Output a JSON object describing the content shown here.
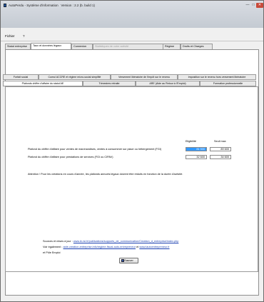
{
  "window": {
    "title": "AutoPerdu - Système d'information",
    "version": "Version : 2.2 (b. build 1)",
    "controls": {
      "minimize": "—",
      "maximize": "□",
      "close": "✕"
    }
  },
  "menu": {
    "file": "Fichier",
    "help": "?"
  },
  "tabs": [
    {
      "label": "Statut entreprise"
    },
    {
      "label": "Taux et données légaux"
    },
    {
      "label": "Connexion"
    },
    {
      "label": "Statistiques de votre activité"
    },
    {
      "label": "Régime"
    },
    {
      "label": "Droits et Charges"
    }
  ],
  "subtabs_row1": [
    {
      "label": "Forfait social"
    },
    {
      "label": "Cumul ACCRE et régime micro-social simplifié"
    },
    {
      "label": "Versement libératoire de l'impôt sur le revenu"
    },
    {
      "label": "Imposition sur le revenu hors versement libératoire"
    }
  ],
  "subtabs_row2": [
    {
      "label": "Plafonds chiffre d'affaire du statut AE"
    },
    {
      "label": "Trimestres retraite"
    },
    {
      "label": "ARE (Aide au Retour à l'Emploi)"
    },
    {
      "label": "Formation professionnelle"
    }
  ],
  "plafonds": {
    "col_eligibility": "Eligibilité",
    "col_threshold": "Seuil max",
    "rows": [
      {
        "label": "Plafond du chiffre d'affaire pour ventes de marchandises, ventes à consommer sur place ou hébergement  (FGI)",
        "eligibility": "81 500",
        "threshold": "89 600"
      },
      {
        "label": "Plafond du chiffre d'affaire pour prestations de services (FGI ou CIPAV)",
        "eligibility": "32 600",
        "threshold": "34 600"
      }
    ],
    "note": "Attention ! Pour les créations en cours d'année, les plafonds annuels légaux doivent être réduits en fonction de la durée d'activité."
  },
  "sources": {
    "line1_prefix": "Sources et mises à jour :",
    "line1_link": "www.le-rsi.fr/publications/supports_de_communication/Creation_d_entreprise/index.php",
    "line2_prefix": "Voir également :",
    "line2_link1": "aide-creation-entreprise.info/regime-fiscal-auto-entrepreneur",
    "line2_and": "et",
    "line2_link2": "www.lautoentrepreneur.fr",
    "line3": "et Pôle Emploi"
  },
  "save_label": "Sauver",
  "icons": {
    "app": "app-icon",
    "save": "save-icon"
  }
}
